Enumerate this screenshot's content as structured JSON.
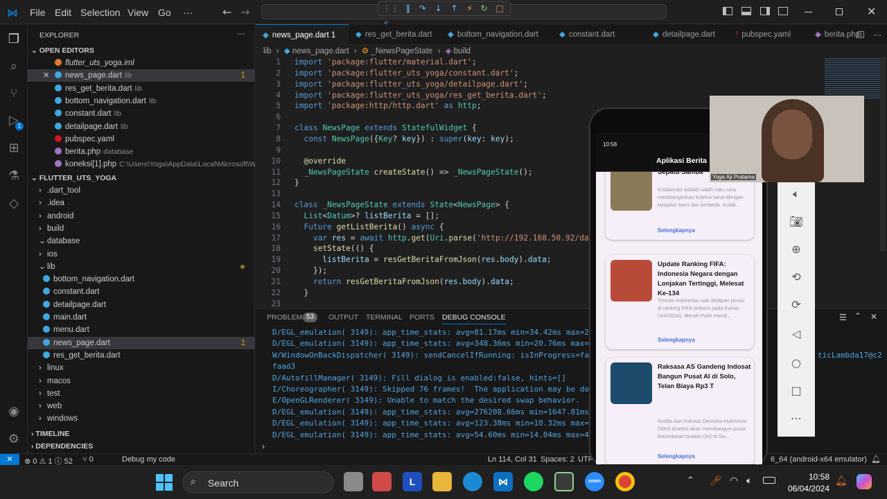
{
  "menu": {
    "items": [
      "File",
      "Edit",
      "Selection",
      "View",
      "Go",
      "···"
    ]
  },
  "explorer": {
    "title": "EXPLORER",
    "open_editors_label": "OPEN EDITORS",
    "open_editors": [
      {
        "name": "flutter_uts_yoga.iml",
        "dir": "",
        "italic": true
      },
      {
        "name": "news_page.dart",
        "dir": "lib",
        "badge": "1",
        "selected": true
      },
      {
        "name": "res_get_berita.dart",
        "dir": "lib"
      },
      {
        "name": "bottom_navigation.dart",
        "dir": "lib"
      },
      {
        "name": "constant.dart",
        "dir": "lib"
      },
      {
        "name": "detailpage.dart",
        "dir": "lib"
      },
      {
        "name": "pubspec.yaml",
        "dir": ""
      },
      {
        "name": "berita.php",
        "dir": "database"
      },
      {
        "name": "koneksi[1].php",
        "dir": "C:\\Users\\Yoga\\AppData\\Local\\Microsoft\\Wi..."
      }
    ],
    "project_label": "FLUTTER_UTS_YOGA",
    "tree": [
      {
        "name": ".dart_tool",
        "kind": "folder",
        "indent": 1
      },
      {
        "name": ".idea",
        "kind": "folder",
        "indent": 1
      },
      {
        "name": "android",
        "kind": "folder",
        "indent": 1
      },
      {
        "name": "build",
        "kind": "folder",
        "indent": 1
      },
      {
        "name": "database",
        "kind": "folder-open",
        "indent": 1
      },
      {
        "name": "ios",
        "kind": "folder",
        "indent": 1
      },
      {
        "name": "lib",
        "kind": "folder-open",
        "indent": 1
      },
      {
        "name": "bottom_navigation.dart",
        "kind": "file",
        "indent": 2
      },
      {
        "name": "constant.dart",
        "kind": "file",
        "indent": 2
      },
      {
        "name": "detailpage.dart",
        "kind": "file",
        "indent": 2
      },
      {
        "name": "main.dart",
        "kind": "file",
        "indent": 2
      },
      {
        "name": "menu.dart",
        "kind": "file",
        "indent": 2
      },
      {
        "name": "news_page.dart",
        "kind": "file",
        "indent": 2,
        "badge": "1",
        "selected": true
      },
      {
        "name": "res_get_berita.dart",
        "kind": "file",
        "indent": 2
      },
      {
        "name": "linux",
        "kind": "folder",
        "indent": 1
      },
      {
        "name": "macos",
        "kind": "folder",
        "indent": 1
      },
      {
        "name": "test",
        "kind": "folder",
        "indent": 1
      },
      {
        "name": "web",
        "kind": "folder",
        "indent": 1
      },
      {
        "name": "windows",
        "kind": "folder",
        "indent": 1
      }
    ],
    "timeline_label": "TIMELINE",
    "dependencies_label": "DEPENDENCIES"
  },
  "tabs": [
    "news_page.dart 1",
    "res_get_berita.dart",
    "bottom_navigation.dart",
    "constant.dart",
    "detailpage.dart",
    "pubspec.yaml",
    "berita.php"
  ],
  "breadcrumb": {
    "items": [
      "lib",
      "news_page.dart",
      "_NewsPageState",
      "build"
    ]
  },
  "code_lines": [
    {
      "n": "1",
      "t": "import 'package:flutter/material.dart';"
    },
    {
      "n": "2",
      "t": "import 'package:flutter_uts_yoga/constant.dart';"
    },
    {
      "n": "3",
      "t": "import 'package:flutter_uts_yoga/detailpage.dart';"
    },
    {
      "n": "4",
      "t": "import 'package:flutter_uts_yoga/res_get_berita.dart';"
    },
    {
      "n": "5",
      "t": "import 'package:http/http.dart' as http;"
    },
    {
      "n": "6",
      "t": ""
    },
    {
      "n": "7",
      "t": "class NewsPage extends StatefulWidget {"
    },
    {
      "n": "8",
      "t": "  const NewsPage({Key? key}) : super(key: key);"
    },
    {
      "n": "9",
      "t": ""
    },
    {
      "n": "10",
      "t": "  @override"
    },
    {
      "n": "11",
      "t": "  _NewsPageState createState() => _NewsPageState();"
    },
    {
      "n": "12",
      "t": "}"
    },
    {
      "n": "13",
      "t": ""
    },
    {
      "n": "14",
      "t": "class _NewsPageState extends State<NewsPage> {"
    },
    {
      "n": "15",
      "t": "  List<Datum>? listBerita = [];"
    },
    {
      "n": "16",
      "t": "  Future getListBerita() async {"
    },
    {
      "n": "17",
      "t": "    var res = await http.get(Uri.parse('http://192.168.50.92/datab"
    },
    {
      "n": "18",
      "t": "    setState(() {"
    },
    {
      "n": "19",
      "t": "      listBerita = resGetBeritaFromJson(res.body).data;"
    },
    {
      "n": "20",
      "t": "    });"
    },
    {
      "n": "21",
      "t": "    return resGetBeritaFromJson(res.body).data;"
    },
    {
      "n": "22",
      "t": "  }"
    },
    {
      "n": "23",
      "t": ""
    }
  ],
  "panel": {
    "tabs": [
      "PROBLEMS",
      "OUTPUT",
      "TERMINAL",
      "PORTS",
      "DEBUG CONSOLE"
    ],
    "problems_count": "53",
    "console_lines": [
      "D/EGL_emulation( 3149): app_time_stats: avg=81.17ms min=34.42ms max=236",
      "D/EGL_emulation( 3149): app_time_stats: avg=348.36ms min=20.76ms max=15",
      "W/WindowOnBackDispatcher( 3149): sendCancelIfRunning: isInProgress=fals",
      "faad3",
      "D/AutofillManager( 3149): Fill dialog is enabled:false, hints=[]",
      "I/Choreographer( 3149): Skipped 76 frames!  The application may be doin",
      "E/OpenGLRenderer( 3149): Unable to match the desired swap behavior.",
      "D/EGL_emulation( 3149): app_time_stats: avg=276208.66ms min=1647.81ms m",
      "D/EGL_emulation( 3149): app_time_stats: avg=123.38ms min=10.32ms max=75",
      "D/EGL_emulation( 3149): app_time_stats: avg=54.60ms min=14.04ms max=401"
    ],
    "right_snippet": "ticLambda17@c2"
  },
  "status": {
    "problems": "⊗ 0 ⚠ 1 ⓘ 52",
    "ports": "⑂ 0",
    "debug": "Debug my code",
    "position": "Ln 114, Col 31",
    "spaces": "Spaces: 2",
    "encoding": "UTF",
    "device": "6_64 (android-x64 emulator)"
  },
  "phone": {
    "time": "10:58",
    "app_title": "Aplikasi Berita",
    "cards": [
      {
        "title": "Sepatu Samba",
        "desc": "Kolaborasi adalah salah satu cara membangkitkan koleksi lama dengan tampilan baru dan berbeda. Kolab...",
        "more": "Selengkapnya"
      },
      {
        "title": "Update Ranking FIFA: Indonesia Negara dengan Lonjakan Tertinggi, Melesat Ke-134",
        "desc": "Timnas Indonesia naik delapan posisi di ranking FIFA terbaru pada Kamis (4/4/2024). Merah Putih mend...",
        "more": "Selengkapnya"
      },
      {
        "title": "Raksasa AS Gandeng Indosat Bangun Pusat AI di Solo, Telan Biaya Rp3 T",
        "desc": "Nvidia dan Indosat Ooredoo Hutchison (IOH) disebut akan membangun pusat kecerdasan buatan (AI) di So...",
        "more": "Selengkapnya"
      }
    ]
  },
  "webcam": {
    "name": "Yoga Aji Pratama"
  },
  "taskbar": {
    "search_label": "Search",
    "time": "10:58",
    "date": "06/04/2024"
  },
  "colors": {
    "accent": "#0078d4",
    "keyword": "#569cd6",
    "string": "#ce9178",
    "type": "#4ec9b0",
    "func": "#dcdcaa",
    "status_remote": "#0078d4"
  }
}
